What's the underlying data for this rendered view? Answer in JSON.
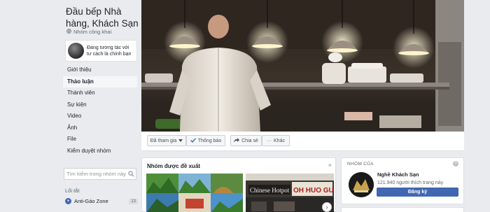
{
  "group": {
    "title": "Đầu bếp Nhà hàng, Khách Sạn",
    "type": "Nhóm công khai",
    "acting_as": "Đang tương tác với tư cách là chính bạn"
  },
  "nav": {
    "items": [
      "Giới thiệu",
      "Thảo luận",
      "Thành viên",
      "Sự kiện",
      "Video",
      "Ảnh",
      "File",
      "Kiểm duyệt nhóm"
    ],
    "active": "Thảo luận"
  },
  "search": {
    "placeholder": "Tìm kiếm trong nhóm này"
  },
  "shortcuts": {
    "heading": "Lối tắt",
    "items": [
      {
        "label": "Anti-Gáo Zone",
        "count": "13"
      }
    ]
  },
  "actions": {
    "joined": "Đã tham gia",
    "notifications": "Thông báo",
    "share": "Chia sẻ",
    "more": "Khác"
  },
  "suggested": {
    "heading": "Nhóm được đề xuất",
    "close": "×",
    "next": "›",
    "sign_text": "Chinese Hotpot",
    "sign_text2": "OH HUO GUO"
  },
  "related": {
    "heading": "NHÓM CỦA",
    "name": "Nghề Khách Sạn",
    "likes": "121.940 người thích trang này",
    "button": "Đăng ký"
  },
  "colors": {
    "primary": "#4267b2",
    "background": "#e9ebee"
  }
}
